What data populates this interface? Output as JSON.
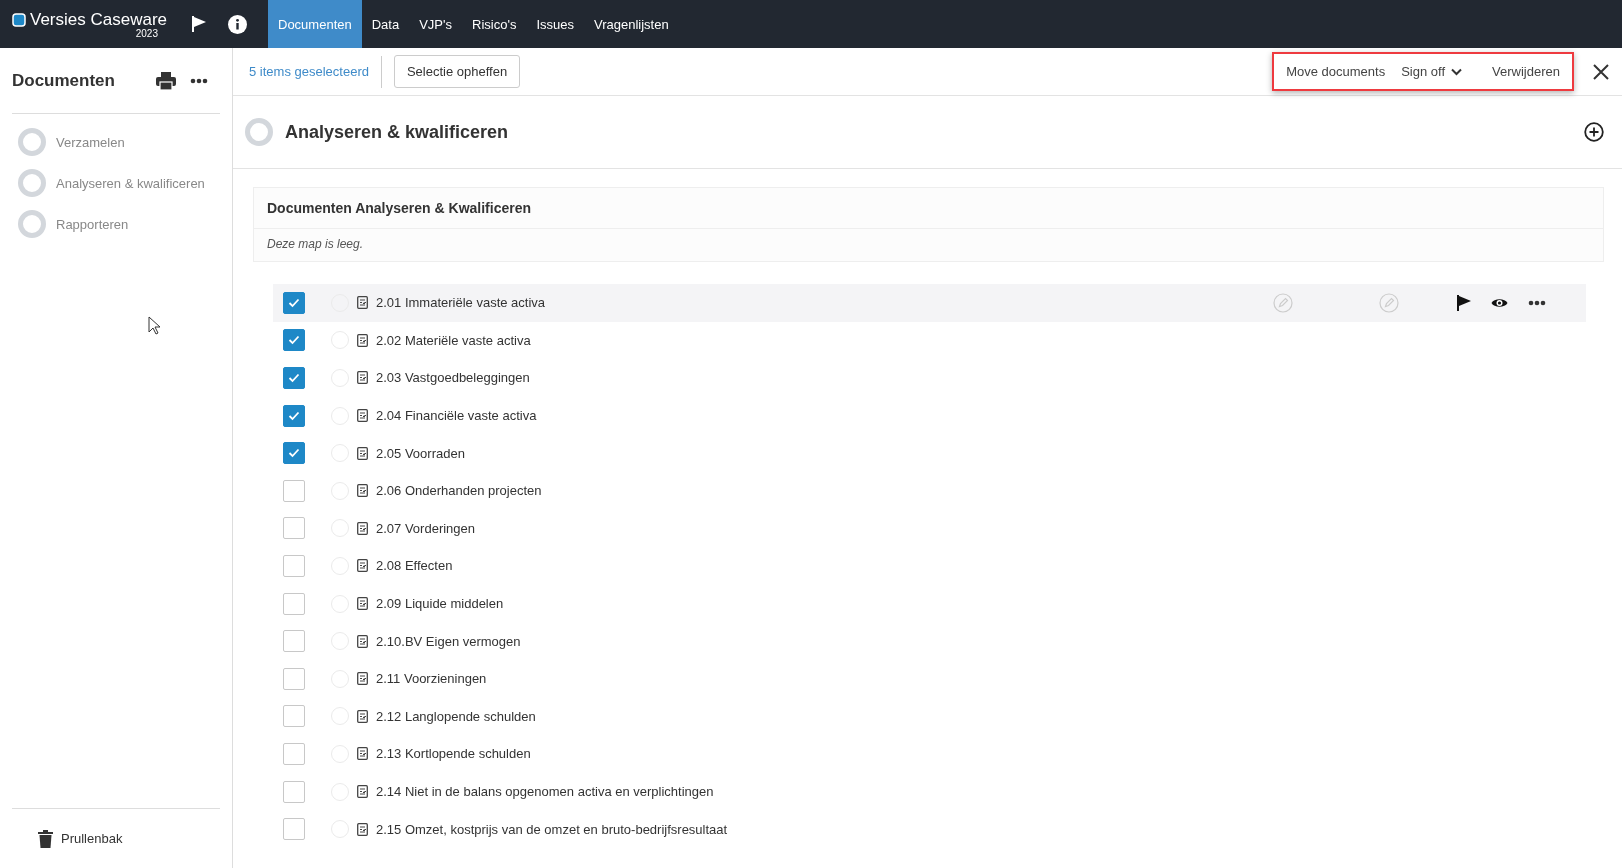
{
  "app": {
    "logo": "Versies Caseware",
    "year": "2023"
  },
  "nav_tabs": [
    {
      "label": "Documenten",
      "selected": true
    },
    {
      "label": "Data",
      "selected": false
    },
    {
      "label": "VJP's",
      "selected": false
    },
    {
      "label": "Risico's",
      "selected": false
    },
    {
      "label": "Issues",
      "selected": false
    },
    {
      "label": "Vragenlijsten",
      "selected": false
    }
  ],
  "sidebar": {
    "title": "Documenten",
    "items": [
      {
        "label": "Verzamelen"
      },
      {
        "label": "Analyseren & kwalificeren"
      },
      {
        "label": "Rapporteren"
      }
    ],
    "trash": "Prullenbak"
  },
  "toolbar": {
    "selection_count": "5 items geselecteerd",
    "clear_button": "Selectie opheffen",
    "actions": [
      {
        "label": "Move documents",
        "kind": "plain"
      },
      {
        "label": "Sign off",
        "kind": "dropdown"
      },
      {
        "label": "Verwijderen",
        "kind": "plain"
      }
    ]
  },
  "section": {
    "title": "Analyseren & kwalificeren"
  },
  "folder": {
    "title": "Documenten Analyseren & Kwalificeren",
    "empty_note": "Deze map is leeg."
  },
  "documents": [
    {
      "name": "2.01 Immateriële vaste activa",
      "checked": true,
      "hovered": true
    },
    {
      "name": "2.02 Materiële vaste activa",
      "checked": true,
      "hovered": false
    },
    {
      "name": "2.03 Vastgoedbeleggingen",
      "checked": true,
      "hovered": false
    },
    {
      "name": "2.04 Financiële vaste activa",
      "checked": true,
      "hovered": false
    },
    {
      "name": "2.05 Voorraden",
      "checked": true,
      "hovered": false
    },
    {
      "name": "2.06 Onderhanden projecten",
      "checked": false,
      "hovered": false
    },
    {
      "name": "2.07 Vorderingen",
      "checked": false,
      "hovered": false
    },
    {
      "name": "2.08 Effecten",
      "checked": false,
      "hovered": false
    },
    {
      "name": "2.09 Liquide middelen",
      "checked": false,
      "hovered": false
    },
    {
      "name": "2.10.BV Eigen vermogen",
      "checked": false,
      "hovered": false
    },
    {
      "name": "2.11 Voorzieningen",
      "checked": false,
      "hovered": false
    },
    {
      "name": "2.12 Langlopende schulden",
      "checked": false,
      "hovered": false
    },
    {
      "name": "2.13 Kortlopende schulden",
      "checked": false,
      "hovered": false
    },
    {
      "name": "2.14 Niet in de balans opgenomen activa en verplichtingen",
      "checked": false,
      "hovered": false
    },
    {
      "name": "2.15 Omzet, kostprijs van de omzet en bruto-bedrijfsresultaat",
      "checked": false,
      "hovered": false
    }
  ]
}
